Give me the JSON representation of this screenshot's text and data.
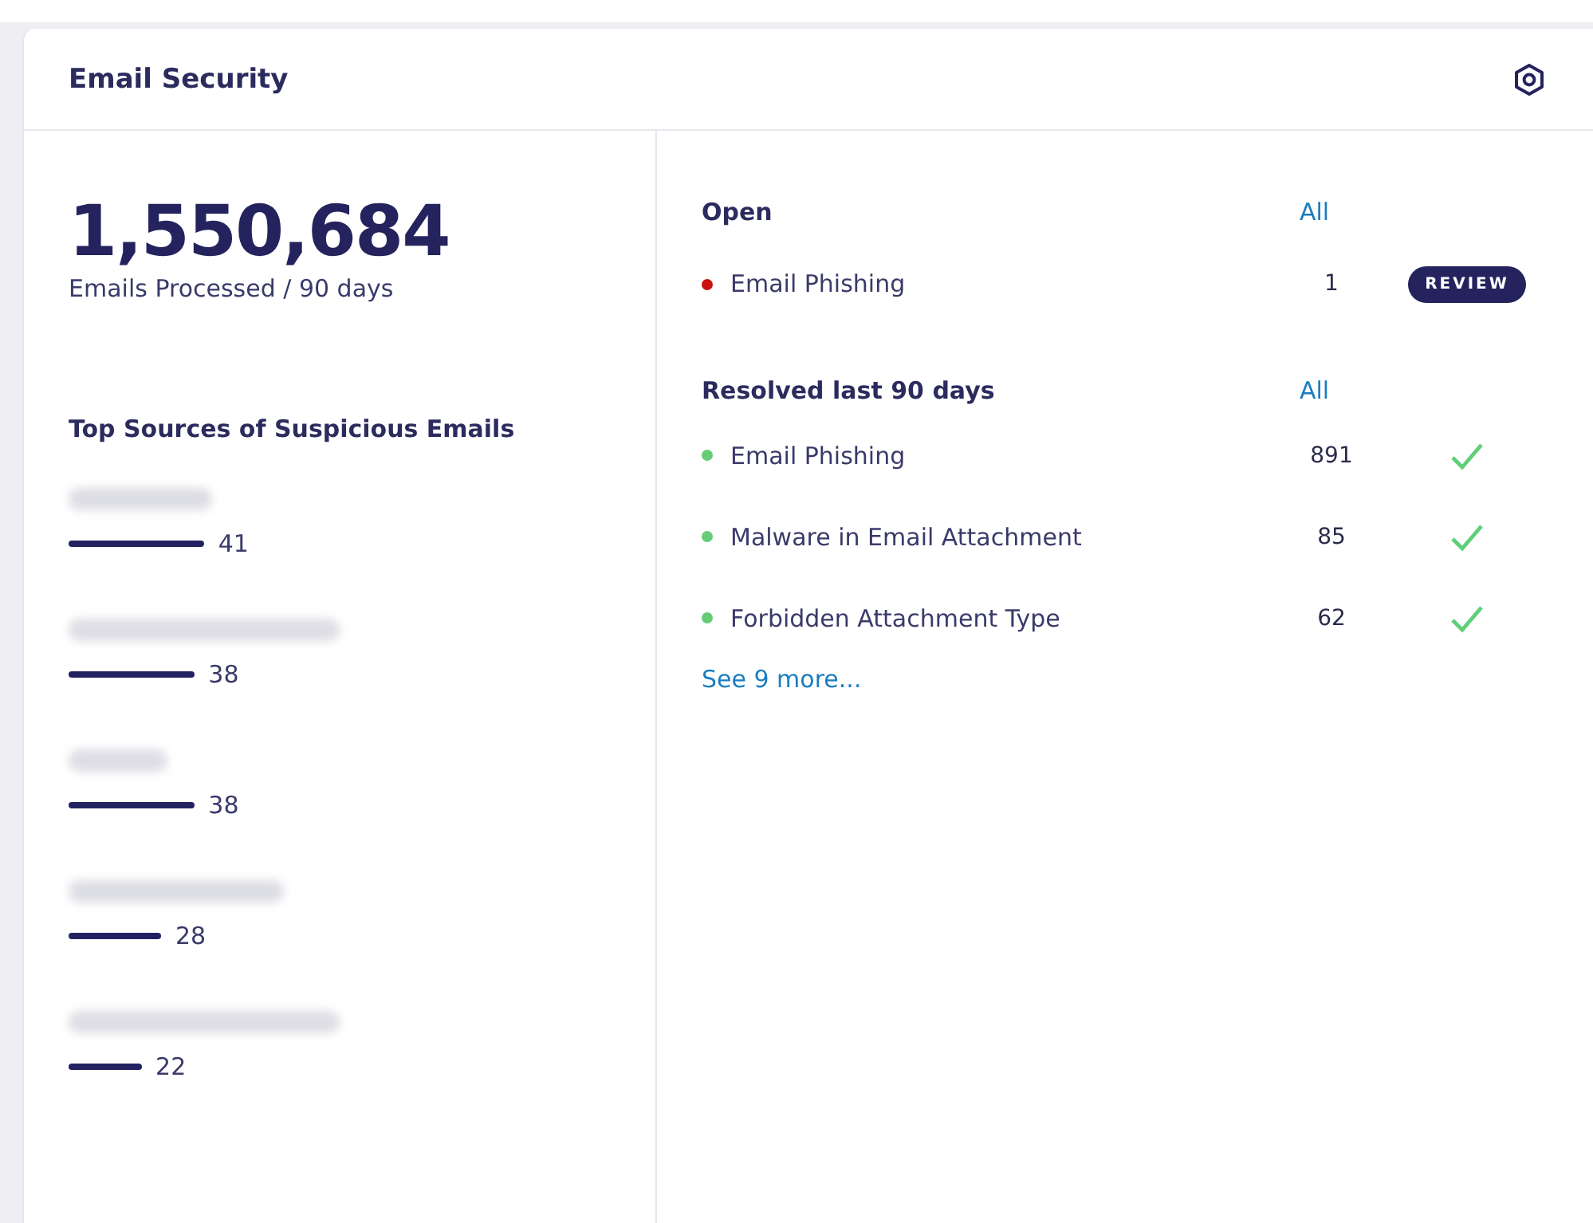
{
  "card": {
    "title": "Email Security"
  },
  "summary": {
    "total": "1,550,684",
    "caption": "Emails Processed / 90 days"
  },
  "sources": {
    "title": "Top Sources of Suspicious Emails",
    "items": [
      {
        "count": "41"
      },
      {
        "count": "38"
      },
      {
        "count": "38"
      },
      {
        "count": "28"
      },
      {
        "count": "22"
      }
    ]
  },
  "sections": [
    {
      "title": "Open",
      "link": "All",
      "rows": [
        {
          "label": "Email Phishing",
          "count": "1",
          "color": "#cc1111",
          "kind": "review",
          "action": "REVIEW"
        }
      ]
    },
    {
      "title": "Resolved last 90 days",
      "link": "All",
      "rows": [
        {
          "label": "Email Phishing",
          "count": "891",
          "color": "#66cc77",
          "kind": "done"
        },
        {
          "label": "Malware in Email Attachment",
          "count": "85",
          "color": "#66cc77",
          "kind": "done"
        },
        {
          "label": "Forbidden Attachment Type",
          "count": "62",
          "color": "#66cc77",
          "kind": "done"
        }
      ],
      "more": "See 9 more..."
    }
  ]
}
